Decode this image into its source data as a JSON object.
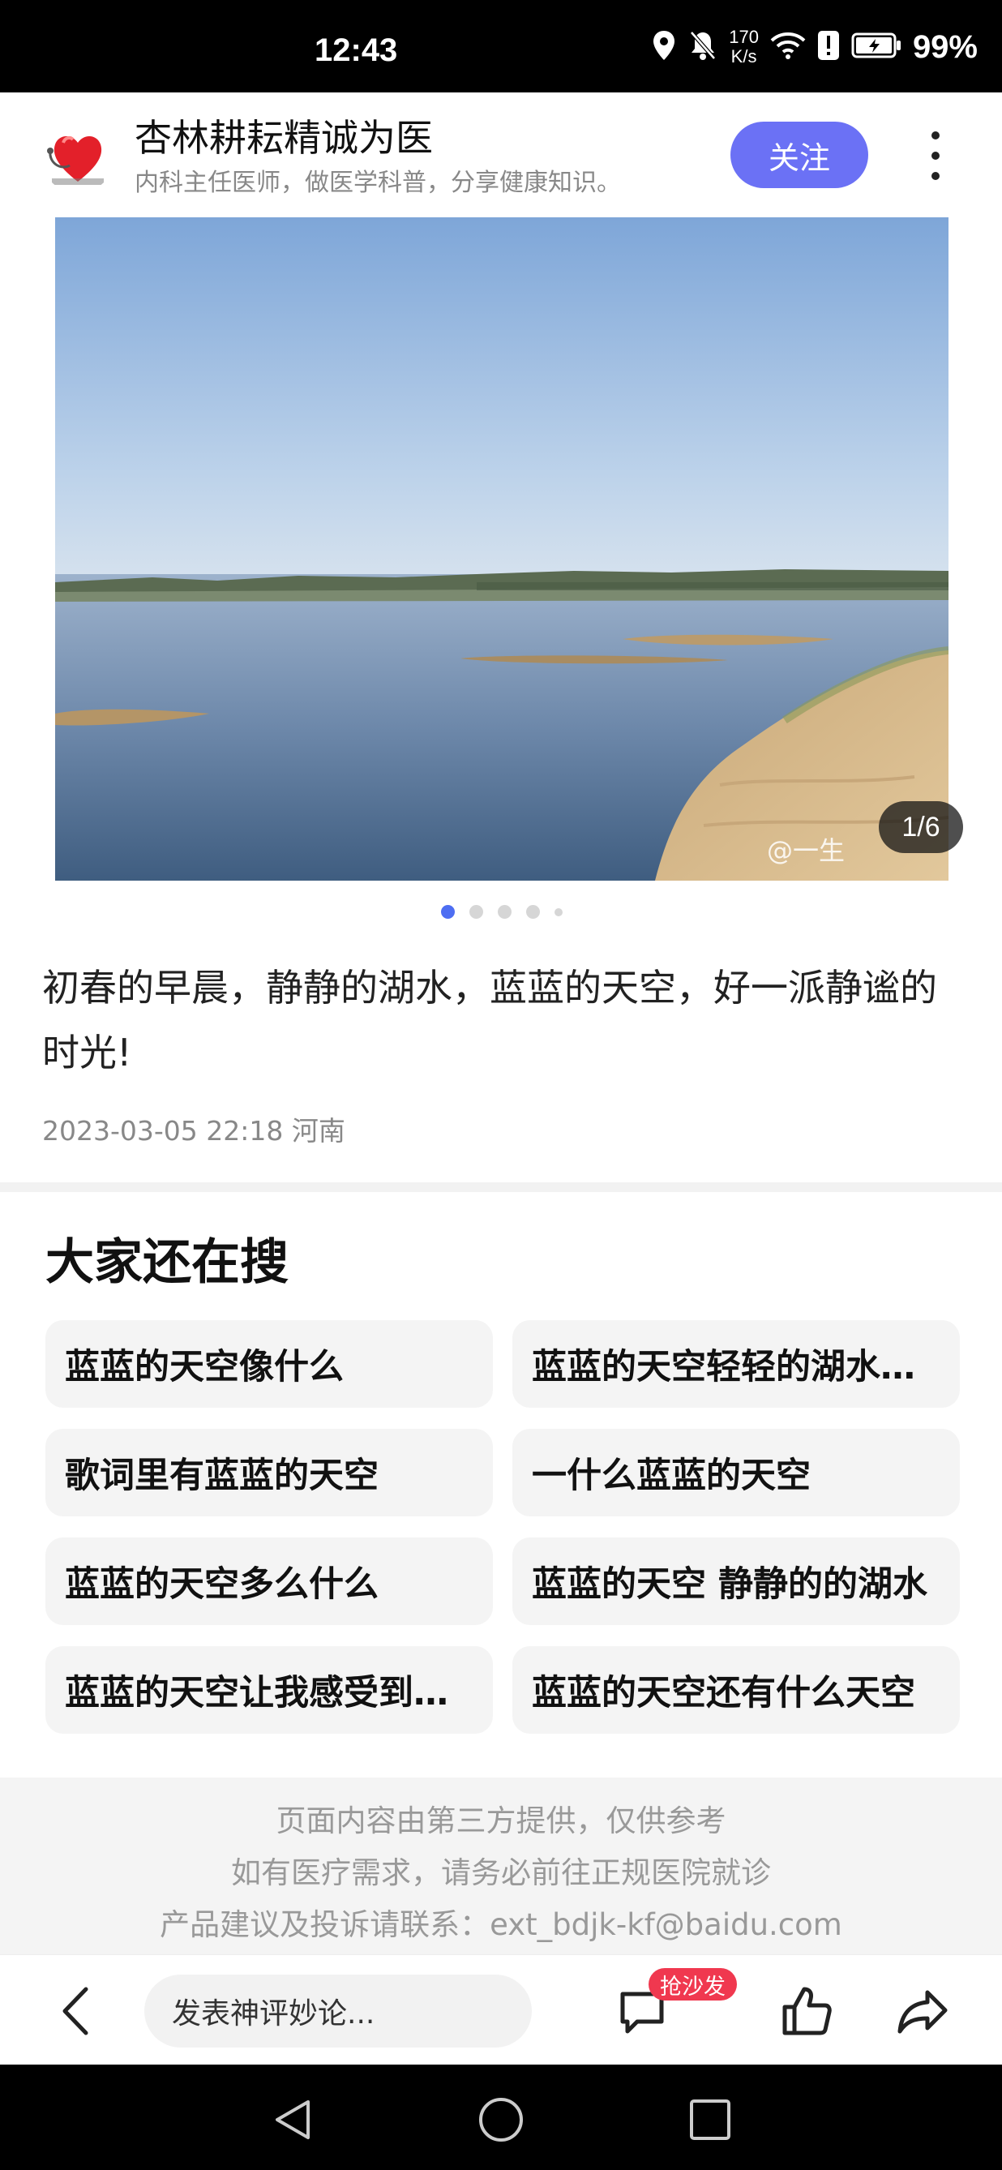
{
  "status_bar": {
    "time": "12:43",
    "net_speed_value": "170",
    "net_speed_unit": "K/s",
    "battery": "99%",
    "icons": [
      "location-icon",
      "mute-icon",
      "wifi-icon",
      "alert-icon",
      "battery-icon"
    ]
  },
  "author": {
    "name": "杏林耕耘精诚为医",
    "description": "内科主任医师，做医学科普，分享健康知识。",
    "follow_label": "关注"
  },
  "photo": {
    "page_indicator": "1/6",
    "watermark": "@一生",
    "total": 6,
    "current": 1
  },
  "post": {
    "caption": "初春的早晨，静静的湖水，蓝蓝的天空，好一派静谧的时光!",
    "meta": "2023-03-05 22:18 河南"
  },
  "related_search": {
    "title": "大家还在搜",
    "items": [
      "蓝蓝的天空像什么",
      "蓝蓝的天空轻轻的湖水谁…",
      "歌词里有蓝蓝的天空",
      "一什么蓝蓝的天空",
      "蓝蓝的天空多么什么",
      "蓝蓝的天空 静静的的湖水",
      "蓝蓝的天空让我感受到什…",
      "蓝蓝的天空还有什么天空"
    ]
  },
  "footer": {
    "line1": "页面内容由第三方提供，仅供参考",
    "line2": "如有医疗需求，请务必前往正规医院就诊",
    "line3": "产品建议及投诉请联系：ext_bdjk-kf@baidu.com"
  },
  "toolbar": {
    "comment_placeholder": "发表神评妙论...",
    "sofa_badge": "抢沙发"
  },
  "colors": {
    "accent": "#6b71f5",
    "badge": "#f0384f",
    "dot_active": "#4e6ef2"
  }
}
